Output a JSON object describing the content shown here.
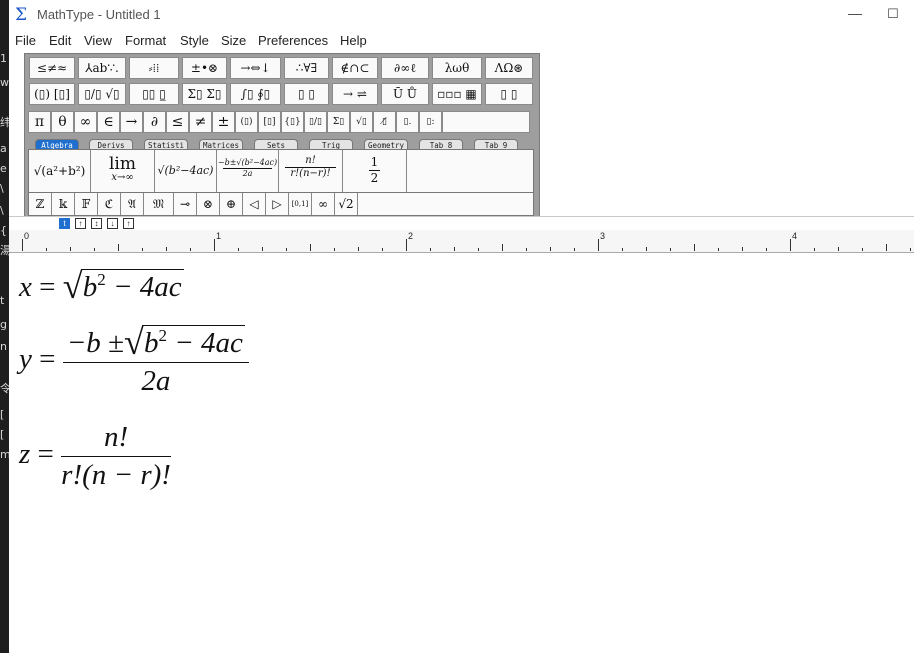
{
  "window": {
    "app_title": "MathType - Untitled 1",
    "minimize": "—",
    "maximize": "☐"
  },
  "menu": [
    "File",
    "Edit",
    "View",
    "Format",
    "Style",
    "Size",
    "Preferences",
    "Help"
  ],
  "left_strip_chars": [
    "1",
    "w",
    "纬",
    "a",
    "e",
    "\\",
    "\\",
    "{",
    "湯",
    "t",
    "g",
    "n",
    "令",
    "[",
    "[",
    "m"
  ],
  "palette": {
    "symbol_row1": [
      "≤≠≈",
      "⅄ab∵.",
      "⸗⁞⁞",
      "±•⊗",
      "→⇔↓",
      "∴∀∃",
      "∉∩⊂",
      "∂∞ℓ",
      "λωθ",
      "ΛΩ⊛"
    ],
    "template_row1": [
      "(▯) [▯]",
      "▯/▯ √▯",
      "▯▯ ▯̲",
      "Σ▯ Σ▯",
      "∫▯ ∮▯",
      "▯ ▯",
      "→ ⇌",
      "Ū Ů",
      "▫▫▫ ▦",
      "▯ ▯"
    ],
    "small_symbols": [
      "π",
      "θ",
      "∞",
      "∈",
      "→",
      "∂",
      "≤",
      "≠",
      "±",
      "(▯)",
      "[▯]",
      "{▯}",
      "▯/▯",
      "Σ▯",
      "√▯",
      "▯̸",
      "▯.",
      "▯:"
    ],
    "tabs": [
      "Algebra",
      "Derivs",
      "Statisti",
      "Matrices",
      "Sets",
      "Trig",
      "Geometry",
      "Tab 8",
      "Tab 9"
    ],
    "templates": {
      "t1": "√(a²+b²)",
      "t2_top": "lim",
      "t2_bottom": "x→∞",
      "t3": "√(b²−4ac)",
      "t4_num": "−b±√(b²−4ac)",
      "t4_den": "2a",
      "t5_num": "n!",
      "t5_den": "r!(n−r)!",
      "t6_num": "1",
      "t6_den": "2"
    },
    "bottom_row": [
      "ℤ",
      "𝕜",
      "𝔽",
      "ℭ",
      "𝔄",
      "𝔐",
      "⊸",
      "⊗",
      "⊕",
      "◁",
      "▷",
      "[0,1]",
      "∞",
      "√2"
    ]
  },
  "style_tabs": [
    "t",
    "↑",
    "↕",
    "↓",
    "↑"
  ],
  "ruler": {
    "labels": [
      "0",
      "1",
      "2",
      "3",
      "4"
    ]
  },
  "equations": {
    "eq1": {
      "lhs": "x",
      "eq": "=",
      "rad_base": "b",
      "rad_exp": "2",
      "rad_rest": "− 4ac"
    },
    "eq2": {
      "lhs": "y",
      "eq": "=",
      "num_pre": "−b ±",
      "rad_base": "b",
      "rad_exp": "2",
      "rad_rest": "− 4ac",
      "den": "2a"
    },
    "eq3": {
      "lhs": "z",
      "eq": "=",
      "num": "n!",
      "den": "r!(n − r)!"
    }
  }
}
